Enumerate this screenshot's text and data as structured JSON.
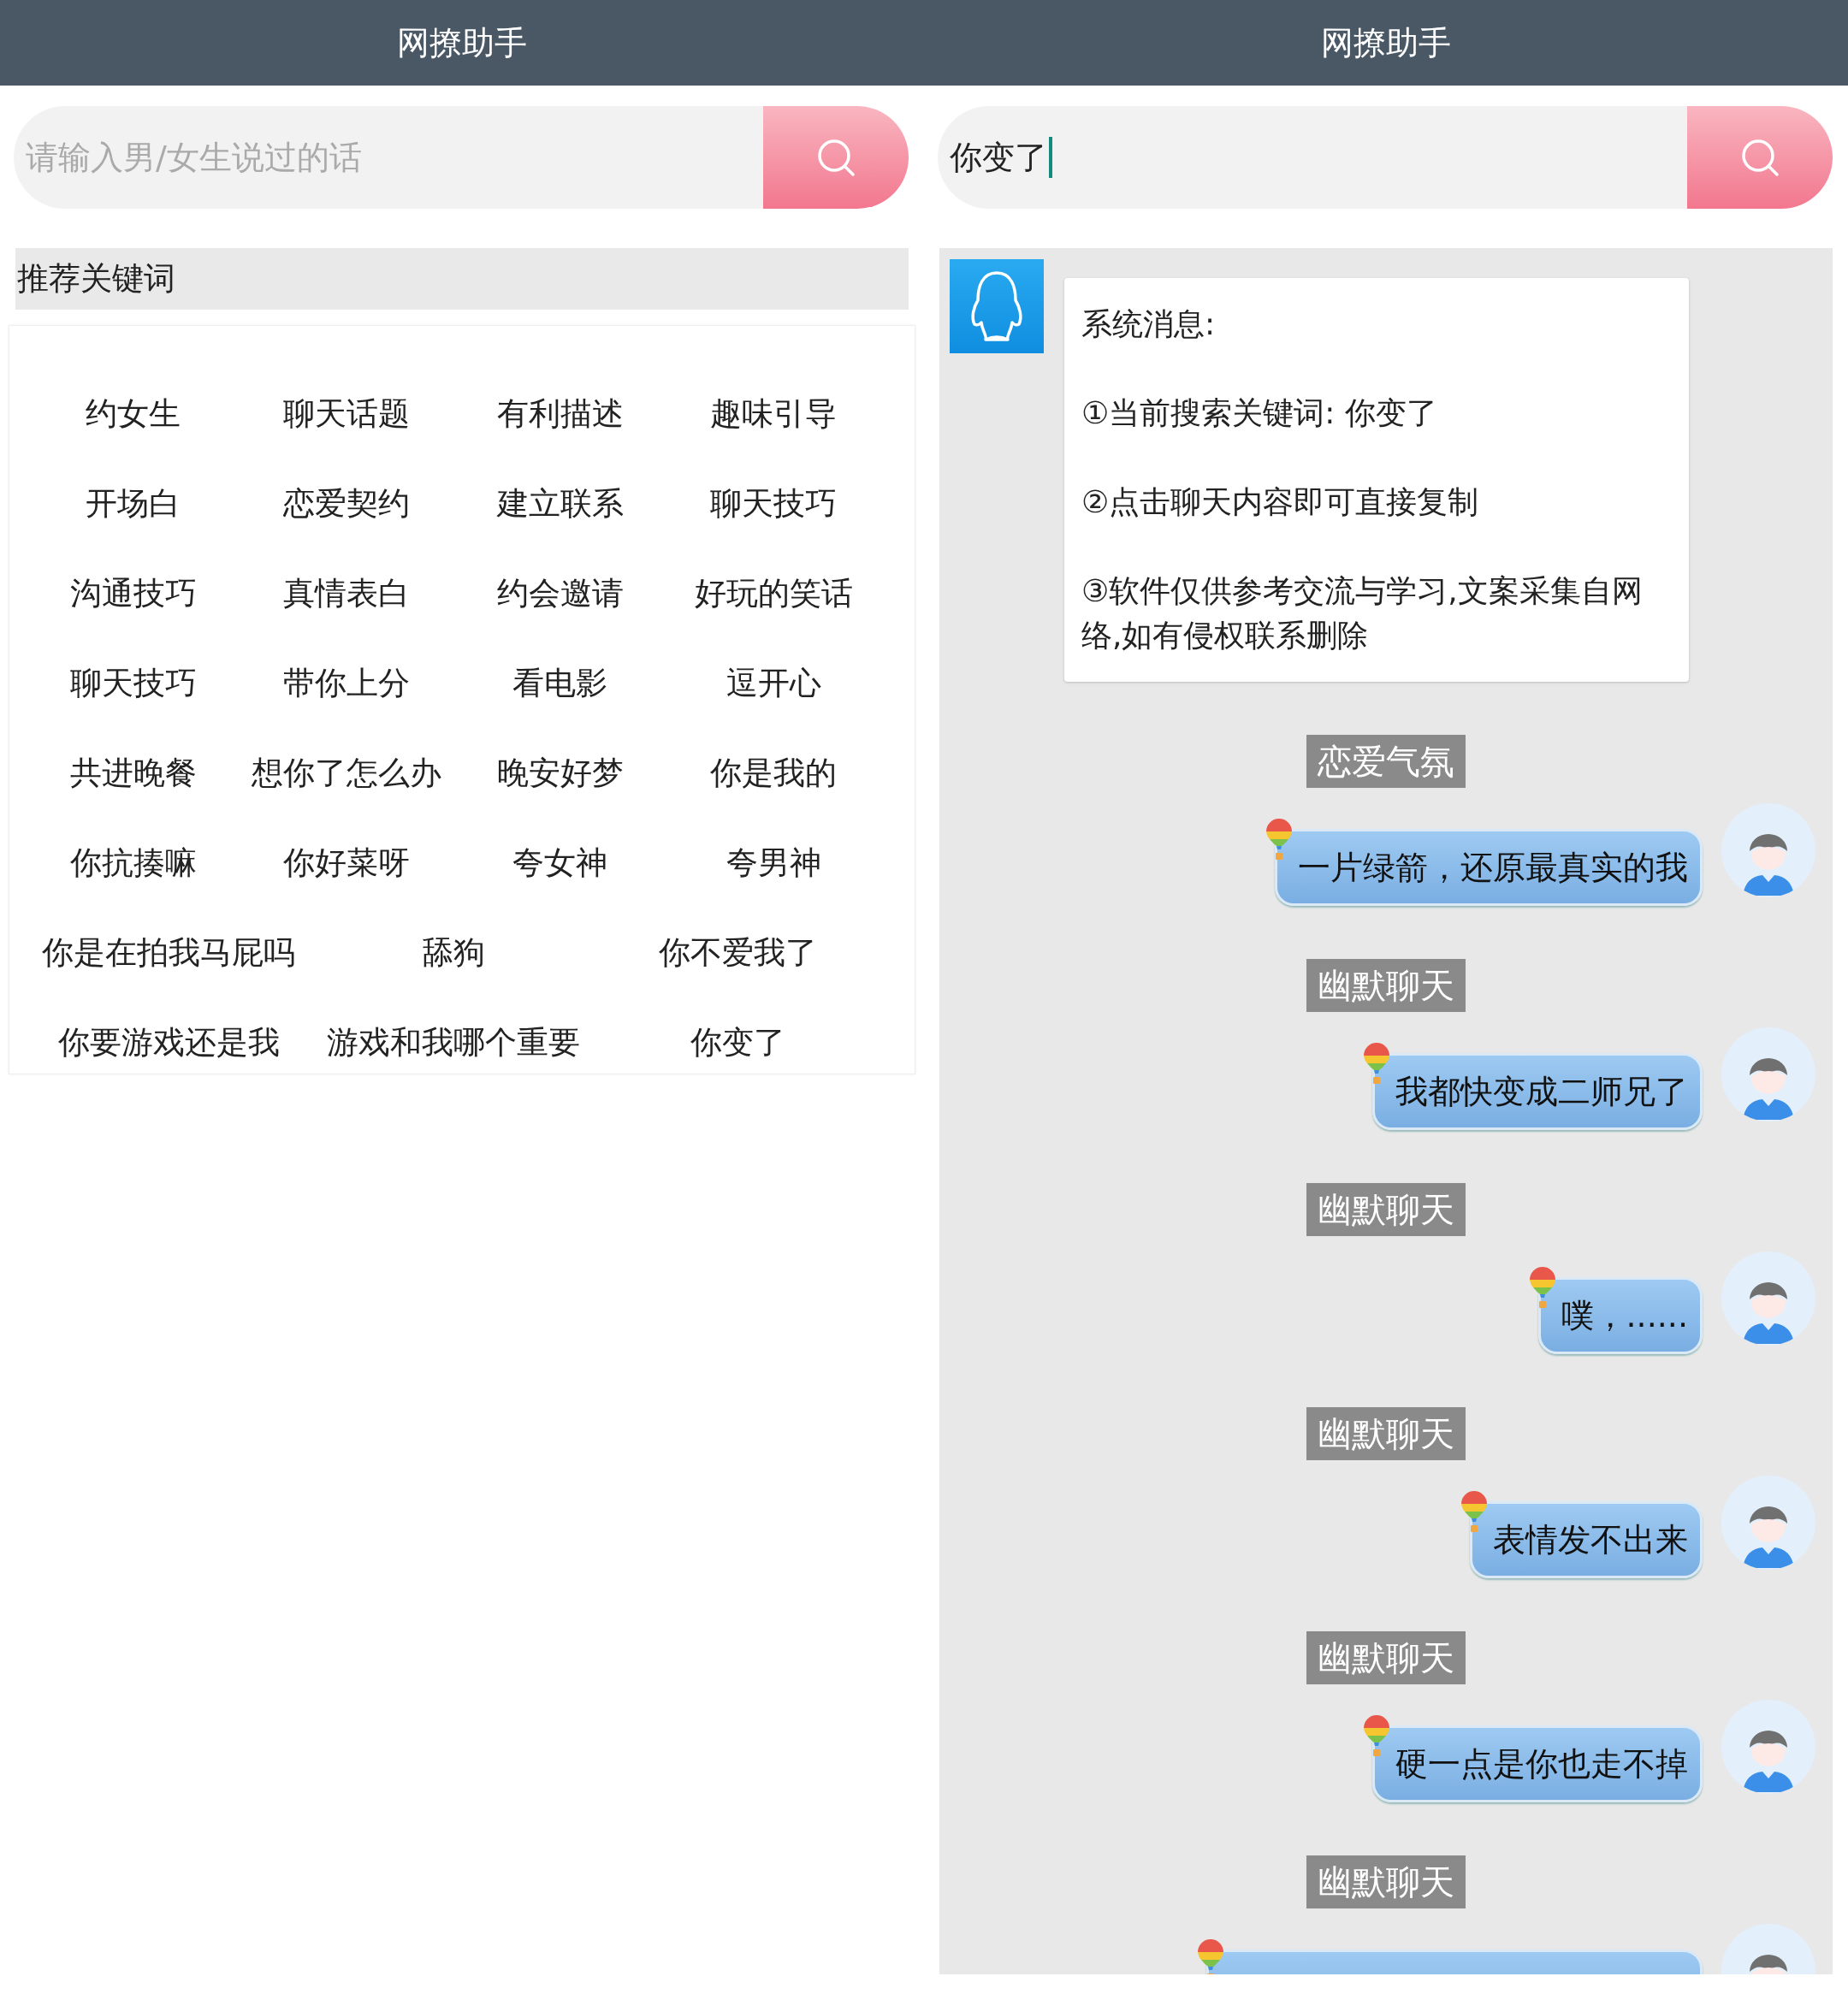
{
  "left": {
    "title": "网撩助手",
    "search": {
      "placeholder": "请输入男/女生说过的话"
    },
    "section_title": "推荐关键词",
    "keyword_rows": [
      [
        "约女生",
        "聊天话题",
        "有利描述",
        "趣味引导"
      ],
      [
        "开场白",
        "恋爱契约",
        "建立联系",
        "聊天技巧"
      ],
      [
        "沟通技巧",
        "真情表白",
        "约会邀请",
        "好玩的笑话"
      ],
      [
        "聊天技巧",
        "带你上分",
        "看电影",
        "逗开心"
      ],
      [
        "共进晚餐",
        "想你了怎么办",
        "晚安好梦",
        "你是我的"
      ],
      [
        "你抗揍嘛",
        "你好菜呀",
        "夸女神",
        "夸男神"
      ],
      [
        "你是在拍我马屁吗",
        "舔狗",
        "你不爱我了"
      ],
      [
        "你要游戏还是我",
        "游戏和我哪个重要",
        "你变了"
      ]
    ]
  },
  "right": {
    "title": "网撩助手",
    "search": {
      "value": "你变了",
      "focused": true
    },
    "system_message": {
      "title": "系统消息:",
      "lines": [
        "①当前搜索关键词: 你变了",
        "②点击聊天内容即可直接复制",
        "③软件仅供参考交流与学习,文案采集自网络,如有侵权联系删除"
      ]
    },
    "messages": [
      {
        "tag": "恋爱气氛",
        "text": "一片绿箭，还原最真实的我"
      },
      {
        "tag": "幽默聊天",
        "text": "我都快变成二师兄了"
      },
      {
        "tag": "幽默聊天",
        "text": "噗，......"
      },
      {
        "tag": "幽默聊天",
        "text": "表情发不出来"
      },
      {
        "tag": "幽默聊天",
        "text": "硬一点是你也走不掉"
      },
      {
        "tag": "幽默聊天"
      }
    ]
  }
}
